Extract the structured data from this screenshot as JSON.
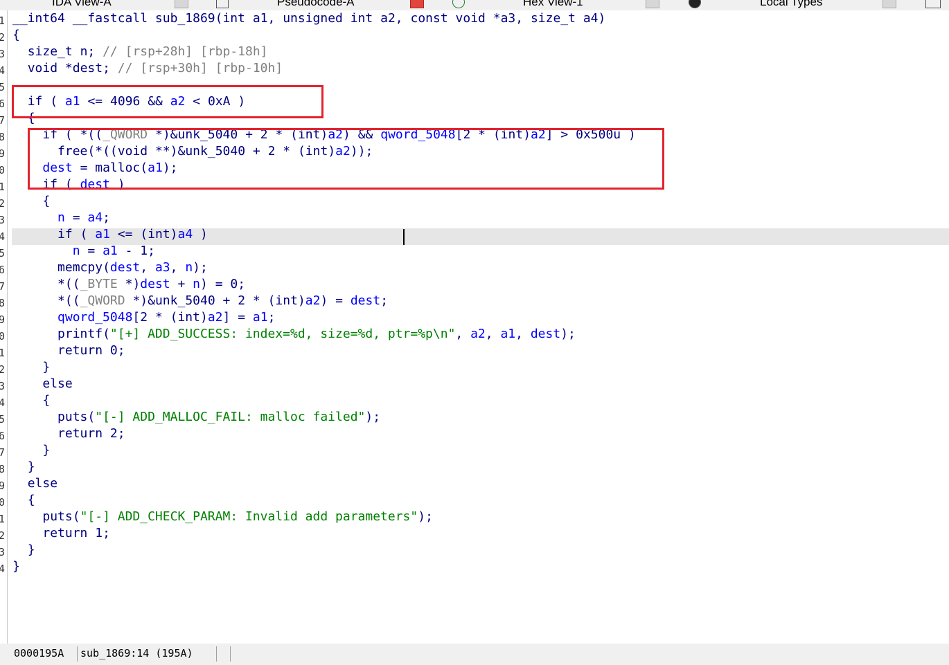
{
  "tabs": [
    {
      "label": "IDA View-A"
    },
    {
      "label": "Pseudocode-A"
    },
    {
      "label": "Hex View-1"
    },
    {
      "label": "Local Types"
    }
  ],
  "line_numbers": [
    "1",
    "2",
    "3",
    "4",
    "5",
    "6",
    "7",
    "8",
    "9",
    "0",
    "1",
    "2",
    "3",
    "4",
    "5",
    "6",
    "7",
    "8",
    "9",
    "0",
    "1",
    "2",
    "3",
    "4",
    "5",
    "6",
    "7",
    "8",
    "9",
    "0",
    "1",
    "2",
    "3",
    "4"
  ],
  "code_lines": [
    "__int64 __fastcall sub_1869(int a1, unsigned int a2, const void *a3, size_t a4)",
    "{",
    "  size_t n; // [rsp+28h] [rbp-18h]",
    "  void *dest; // [rsp+30h] [rbp-10h]",
    "",
    "  if ( a1 <= 4096 && a2 < 0xA )",
    "  {",
    "    if ( *((_QWORD *)&unk_5040 + 2 * (int)a2) && qword_5048[2 * (int)a2] > 0x500u )",
    "      free(*((void **)&unk_5040 + 2 * (int)a2));",
    "    dest = malloc(a1);",
    "    if ( dest )",
    "    {",
    "      n = a4;",
    "      if ( a1 <= (int)a4 )",
    "        n = a1 - 1;",
    "      memcpy(dest, a3, n);",
    "      *((_BYTE *)dest + n) = 0;",
    "      *((_QWORD *)&unk_5040 + 2 * (int)a2) = dest;",
    "      qword_5048[2 * (int)a2] = a1;",
    "      printf(\"[+] ADD_SUCCESS: index=%d, size=%d, ptr=%p\\n\", a2, a1, dest);",
    "      return 0;",
    "    }",
    "    else",
    "    {",
    "      puts(\"[-] ADD_MALLOC_FAIL: malloc failed\");",
    "      return 2;",
    "    }",
    "  }",
    "  else",
    "  {",
    "    puts(\"[-] ADD_CHECK_PARAM: Invalid add parameters\");",
    "    return 1;",
    "  }",
    "}"
  ],
  "status": {
    "address": "0000195A",
    "location": "sub_1869:14 (195A)"
  },
  "colors": {
    "keyword": "#000080",
    "variable": "#0000ff",
    "comment": "#808080",
    "string": "#008000",
    "highlight_box": "#e3232c",
    "current_line": "#e6e6e6"
  }
}
